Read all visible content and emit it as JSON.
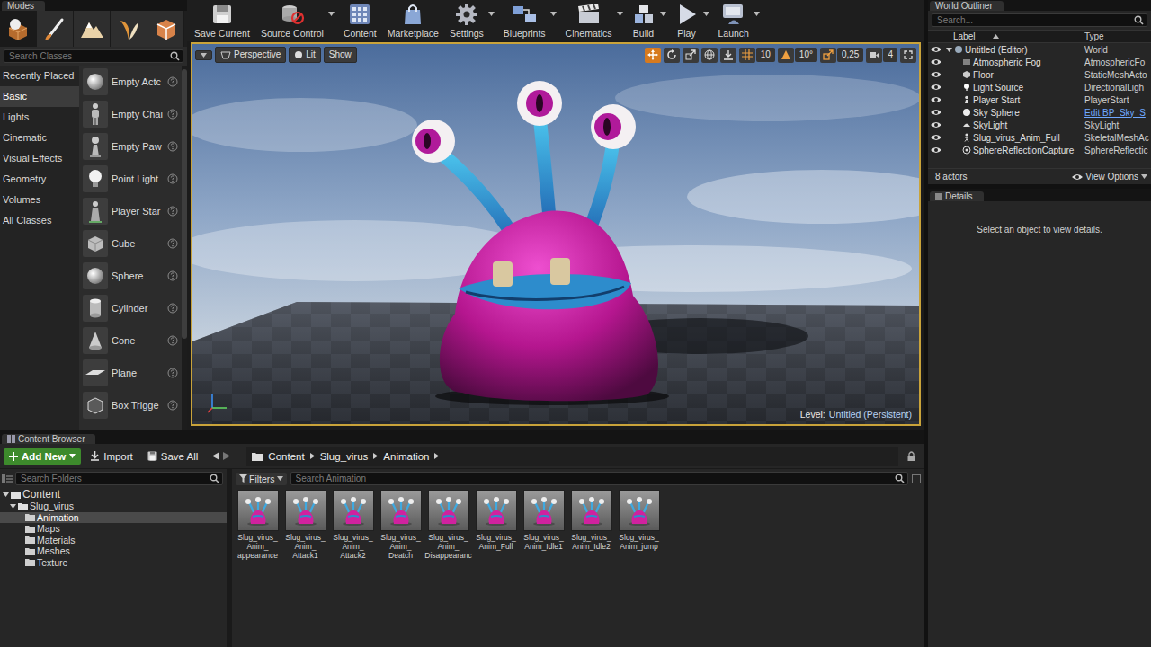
{
  "modes_panel": {
    "tab": "Modes",
    "tools": [
      {
        "kind": "place",
        "selected": true
      },
      {
        "kind": "paint",
        "selected": false
      },
      {
        "kind": "landscape",
        "selected": false
      },
      {
        "kind": "foliage",
        "selected": false
      },
      {
        "kind": "geometry",
        "selected": false
      }
    ],
    "search": {
      "placeholder": "Search Classes"
    },
    "categories": [
      {
        "label": "Recently Placed",
        "selected": false
      },
      {
        "label": "Basic",
        "selected": true
      },
      {
        "label": "Lights",
        "selected": false
      },
      {
        "label": "Cinematic",
        "selected": false
      },
      {
        "label": "Visual Effects",
        "selected": false
      },
      {
        "label": "Geometry",
        "selected": false
      },
      {
        "label": "Volumes",
        "selected": false
      },
      {
        "label": "All Classes",
        "selected": false
      }
    ],
    "items": [
      {
        "label": "Empty Actc",
        "kind": "sphere"
      },
      {
        "label": "Empty Chai",
        "kind": "character"
      },
      {
        "label": "Empty Paw",
        "kind": "pawn"
      },
      {
        "label": "Point Light",
        "kind": "light"
      },
      {
        "label": "Player Star",
        "kind": "flag"
      },
      {
        "label": "Cube",
        "kind": "cube"
      },
      {
        "label": "Sphere",
        "kind": "sphere"
      },
      {
        "label": "Cylinder",
        "kind": "cylinder"
      },
      {
        "label": "Cone",
        "kind": "cone"
      },
      {
        "label": "Plane",
        "kind": "plane"
      },
      {
        "label": "Box Trigge",
        "kind": "box"
      }
    ]
  },
  "toolbar": {
    "buttons": [
      {
        "label": "Save Current",
        "kind": "save",
        "dropdown": false
      },
      {
        "label": "Source Control",
        "kind": "source",
        "dropdown": true
      },
      {
        "label": "Content",
        "kind": "content",
        "dropdown": false
      },
      {
        "label": "Marketplace",
        "kind": "market",
        "dropdown": false
      },
      {
        "label": "Settings",
        "kind": "settings",
        "dropdown": true
      },
      {
        "label": "Blueprints",
        "kind": "blueprints",
        "dropdown": true
      },
      {
        "label": "Cinematics",
        "kind": "cinematics",
        "dropdown": true
      },
      {
        "label": "Build",
        "kind": "build",
        "dropdown": true
      },
      {
        "label": "Play",
        "kind": "play",
        "dropdown": true
      },
      {
        "label": "Launch",
        "kind": "launch",
        "dropdown": true
      }
    ]
  },
  "viewport": {
    "view": "Perspective",
    "lighting": "Lit",
    "show": "Show",
    "transform_tools": [
      {
        "kind": "translate",
        "selected": true
      },
      {
        "kind": "rotate",
        "selected": false
      },
      {
        "kind": "scale",
        "selected": false
      }
    ],
    "snaps": [
      {
        "kind": "grid",
        "value": "10",
        "on": true
      },
      {
        "kind": "rotation",
        "value": "10°",
        "on": true
      },
      {
        "kind": "scale",
        "value": "0,25",
        "on": true
      }
    ],
    "camera_speed": "4",
    "level_label": "Level:",
    "level_name": "Untitled (Persistent)"
  },
  "world_outliner": {
    "tab": "World Outliner",
    "search": {
      "placeholder": "Search..."
    },
    "columns": [
      "Label",
      "Type"
    ],
    "root": {
      "label": "Untitled (Editor)",
      "type": "World",
      "expanded": true,
      "visible": true
    },
    "actors": [
      {
        "label": "Atmospheric Fog",
        "type": "AtmosphericFo",
        "kind": "fog",
        "type_link": false,
        "visible": true
      },
      {
        "label": "Floor",
        "type": "StaticMeshActo",
        "kind": "mesh",
        "type_link": false,
        "visible": true
      },
      {
        "label": "Light Source",
        "type": "DirectionalLigh",
        "kind": "light",
        "type_link": false,
        "visible": true
      },
      {
        "label": "Player Start",
        "type": "PlayerStart",
        "kind": "player",
        "type_link": false,
        "visible": true
      },
      {
        "label": "Sky Sphere",
        "type": "Edit BP_Sky_S",
        "kind": "sphere",
        "type_link": true,
        "visible": true
      },
      {
        "label": "SkyLight",
        "type": "SkyLight",
        "kind": "skylight",
        "type_link": false,
        "visible": true
      },
      {
        "label": "Slug_virus_Anim_Full",
        "type": "SkeletalMeshAc",
        "kind": "skeletal",
        "type_link": false,
        "visible": true
      },
      {
        "label": "SphereReflectionCapture",
        "type": "SphereReflectic",
        "kind": "reflection",
        "type_link": false,
        "visible": true
      }
    ],
    "count": "8 actors",
    "view_options": "View Options"
  },
  "details": {
    "tab": "Details",
    "message": "Select an object to view details."
  },
  "content_browser": {
    "tab": "Content Browser",
    "add_new": "Add New",
    "import": "Import",
    "save_all": "Save All",
    "path": [
      "Content",
      "Slug_virus",
      "Animation"
    ],
    "folder_search": {
      "placeholder": "Search Folders"
    },
    "tree": {
      "label": "Content",
      "expanded": true,
      "selected": false,
      "children": [
        {
          "label": "Slug_virus",
          "expanded": true,
          "selected": false,
          "children": [
            {
              "label": "Animation",
              "expanded": false,
              "selected": true,
              "children": []
            },
            {
              "label": "Maps",
              "expanded": false,
              "selected": false,
              "children": []
            },
            {
              "label": "Materials",
              "expanded": false,
              "selected": false,
              "children": []
            },
            {
              "label": "Meshes",
              "expanded": false,
              "selected": false,
              "children": []
            },
            {
              "label": "Texture",
              "expanded": false,
              "selected": false,
              "children": []
            }
          ]
        }
      ]
    },
    "filters": "Filters",
    "asset_search": {
      "placeholder": "Search Animation"
    },
    "assets": [
      {
        "lines": [
          "Slug_virus_",
          "Anim_",
          "appearance"
        ]
      },
      {
        "lines": [
          "Slug_virus_",
          "Anim_",
          "Attack1"
        ]
      },
      {
        "lines": [
          "Slug_virus_",
          "Anim_",
          "Attack2"
        ]
      },
      {
        "lines": [
          "Slug_virus_",
          "Anim_",
          "Deatch"
        ]
      },
      {
        "lines": [
          "Slug_virus_",
          "Anim_",
          "Disappearanc"
        ]
      },
      {
        "lines": [
          "Slug_virus_",
          "Anim_Full"
        ]
      },
      {
        "lines": [
          "Slug_virus_",
          "Anim_Idle1"
        ]
      },
      {
        "lines": [
          "Slug_virus_",
          "Anim_Idle2"
        ]
      },
      {
        "lines": [
          "Slug_virus_",
          "Anim_jump"
        ]
      }
    ]
  }
}
